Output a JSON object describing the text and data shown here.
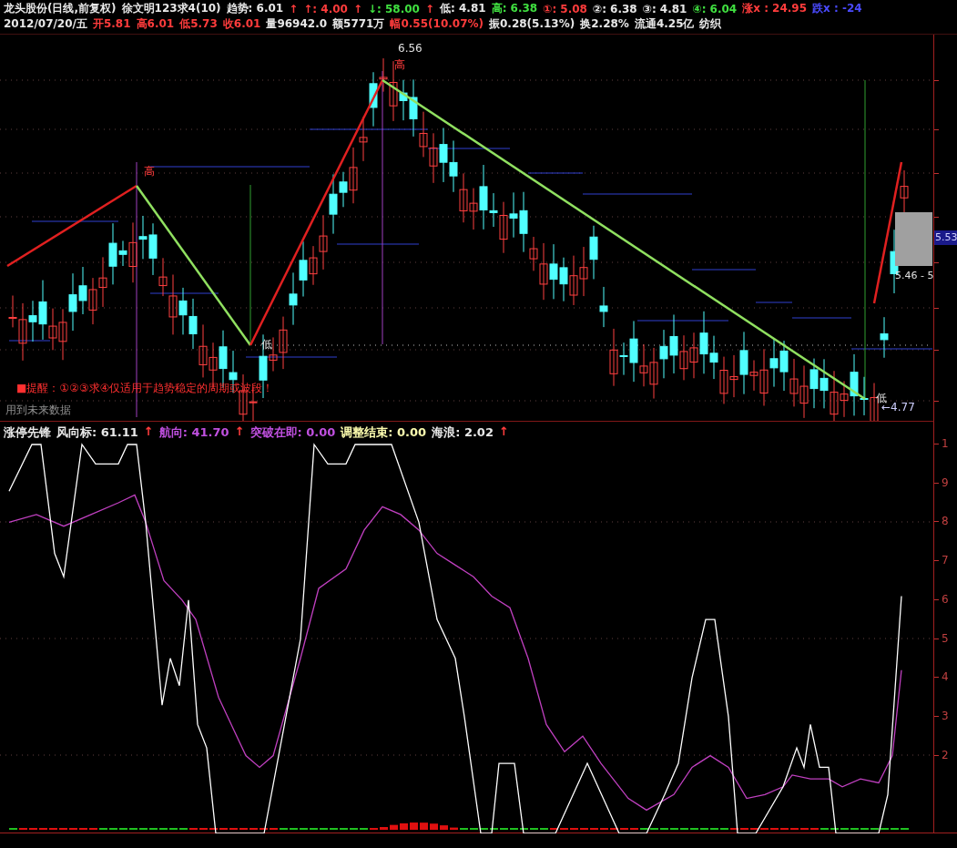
{
  "header": {
    "line_1": [
      {
        "text": "龙头股份(日线,前复权)",
        "color": "#e8e8e8"
      },
      {
        "text": "徐文明123求4(10)",
        "color": "#e8e8e8"
      },
      {
        "text": "趋势: 6.01",
        "color": "#e8e8e8"
      },
      {
        "text": "↑",
        "color": "#ff3c3c"
      },
      {
        "text": "↑: 4.00",
        "color": "#ff3c3c"
      },
      {
        "text": "↑",
        "color": "#ff3c3c"
      },
      {
        "text": "↓: 58.00",
        "color": "#40e040"
      },
      {
        "text": "↑",
        "color": "#ff3c3c"
      },
      {
        "text": "低: 4.81",
        "color": "#e8e8e8"
      },
      {
        "text": "高: 6.38",
        "color": "#40e040"
      },
      {
        "text": "①: 5.08",
        "color": "#ff3c3c"
      },
      {
        "text": "②: 6.38",
        "color": "#e8e8e8"
      },
      {
        "text": "③: 4.81",
        "color": "#e8e8e8"
      },
      {
        "text": "④: 6.04",
        "color": "#40e040"
      },
      {
        "text": "涨x : 24.95",
        "color": "#ff3c3c"
      },
      {
        "text": "跌x : -24",
        "color": "#4a4aff"
      }
    ],
    "line_2": [
      {
        "text": "2012/07/20/五",
        "color": "#e8e8e8"
      },
      {
        "text": "开5.81",
        "color": "#ff3c3c"
      },
      {
        "text": "高6.01",
        "color": "#ff3c3c"
      },
      {
        "text": "低5.73",
        "color": "#ff3c3c"
      },
      {
        "text": "收6.01",
        "color": "#ff3c3c"
      },
      {
        "text": "量96942.0",
        "color": "#e8e8e8"
      },
      {
        "text": "额5771万",
        "color": "#e8e8e8"
      },
      {
        "text": "幅0.55(10.07%)",
        "color": "#ff3c3c"
      },
      {
        "text": "振0.28(5.13%)",
        "color": "#e8e8e8"
      },
      {
        "text": "换2.28%",
        "color": "#e8e8e8"
      },
      {
        "text": "流通4.25亿",
        "color": "#e8e8e8"
      },
      {
        "text": "纺织",
        "color": "#e8e8e8"
      }
    ]
  },
  "price_chart": {
    "peak_label": "6.56",
    "trough_label": "←4.77",
    "high_marks": [
      "高",
      "高"
    ],
    "low_marks": [
      "低",
      "低"
    ],
    "range_label": "5.46 - 5",
    "price_tag": "5.53",
    "note": "■提醒：①②③求④仅适用于趋势稳定的周期或波段！",
    "future_data_warning": "用到未来数据"
  },
  "indicator": {
    "title": [
      {
        "text": "涨停先锋",
        "color": "#e8e8e8"
      },
      {
        "text": "风向标: 61.11",
        "color": "#e8e8e8"
      },
      {
        "text": "↑",
        "color": "#ff3c3c"
      },
      {
        "text": "航向: 41.70",
        "color": "#c050e0"
      },
      {
        "text": "↑",
        "color": "#ff3c3c"
      },
      {
        "text": "突破在即: 0.00",
        "color": "#c050e0"
      },
      {
        "text": "调整结束: 0.00",
        "color": "#ffffb0"
      },
      {
        "text": "海浪: 2.02",
        "color": "#e8e8e8"
      },
      {
        "text": "↑",
        "color": "#ff3c3c"
      }
    ],
    "axis_labels": [
      "1",
      "9",
      "8",
      "7",
      "6",
      "5",
      "4",
      "3",
      "2"
    ]
  }
}
